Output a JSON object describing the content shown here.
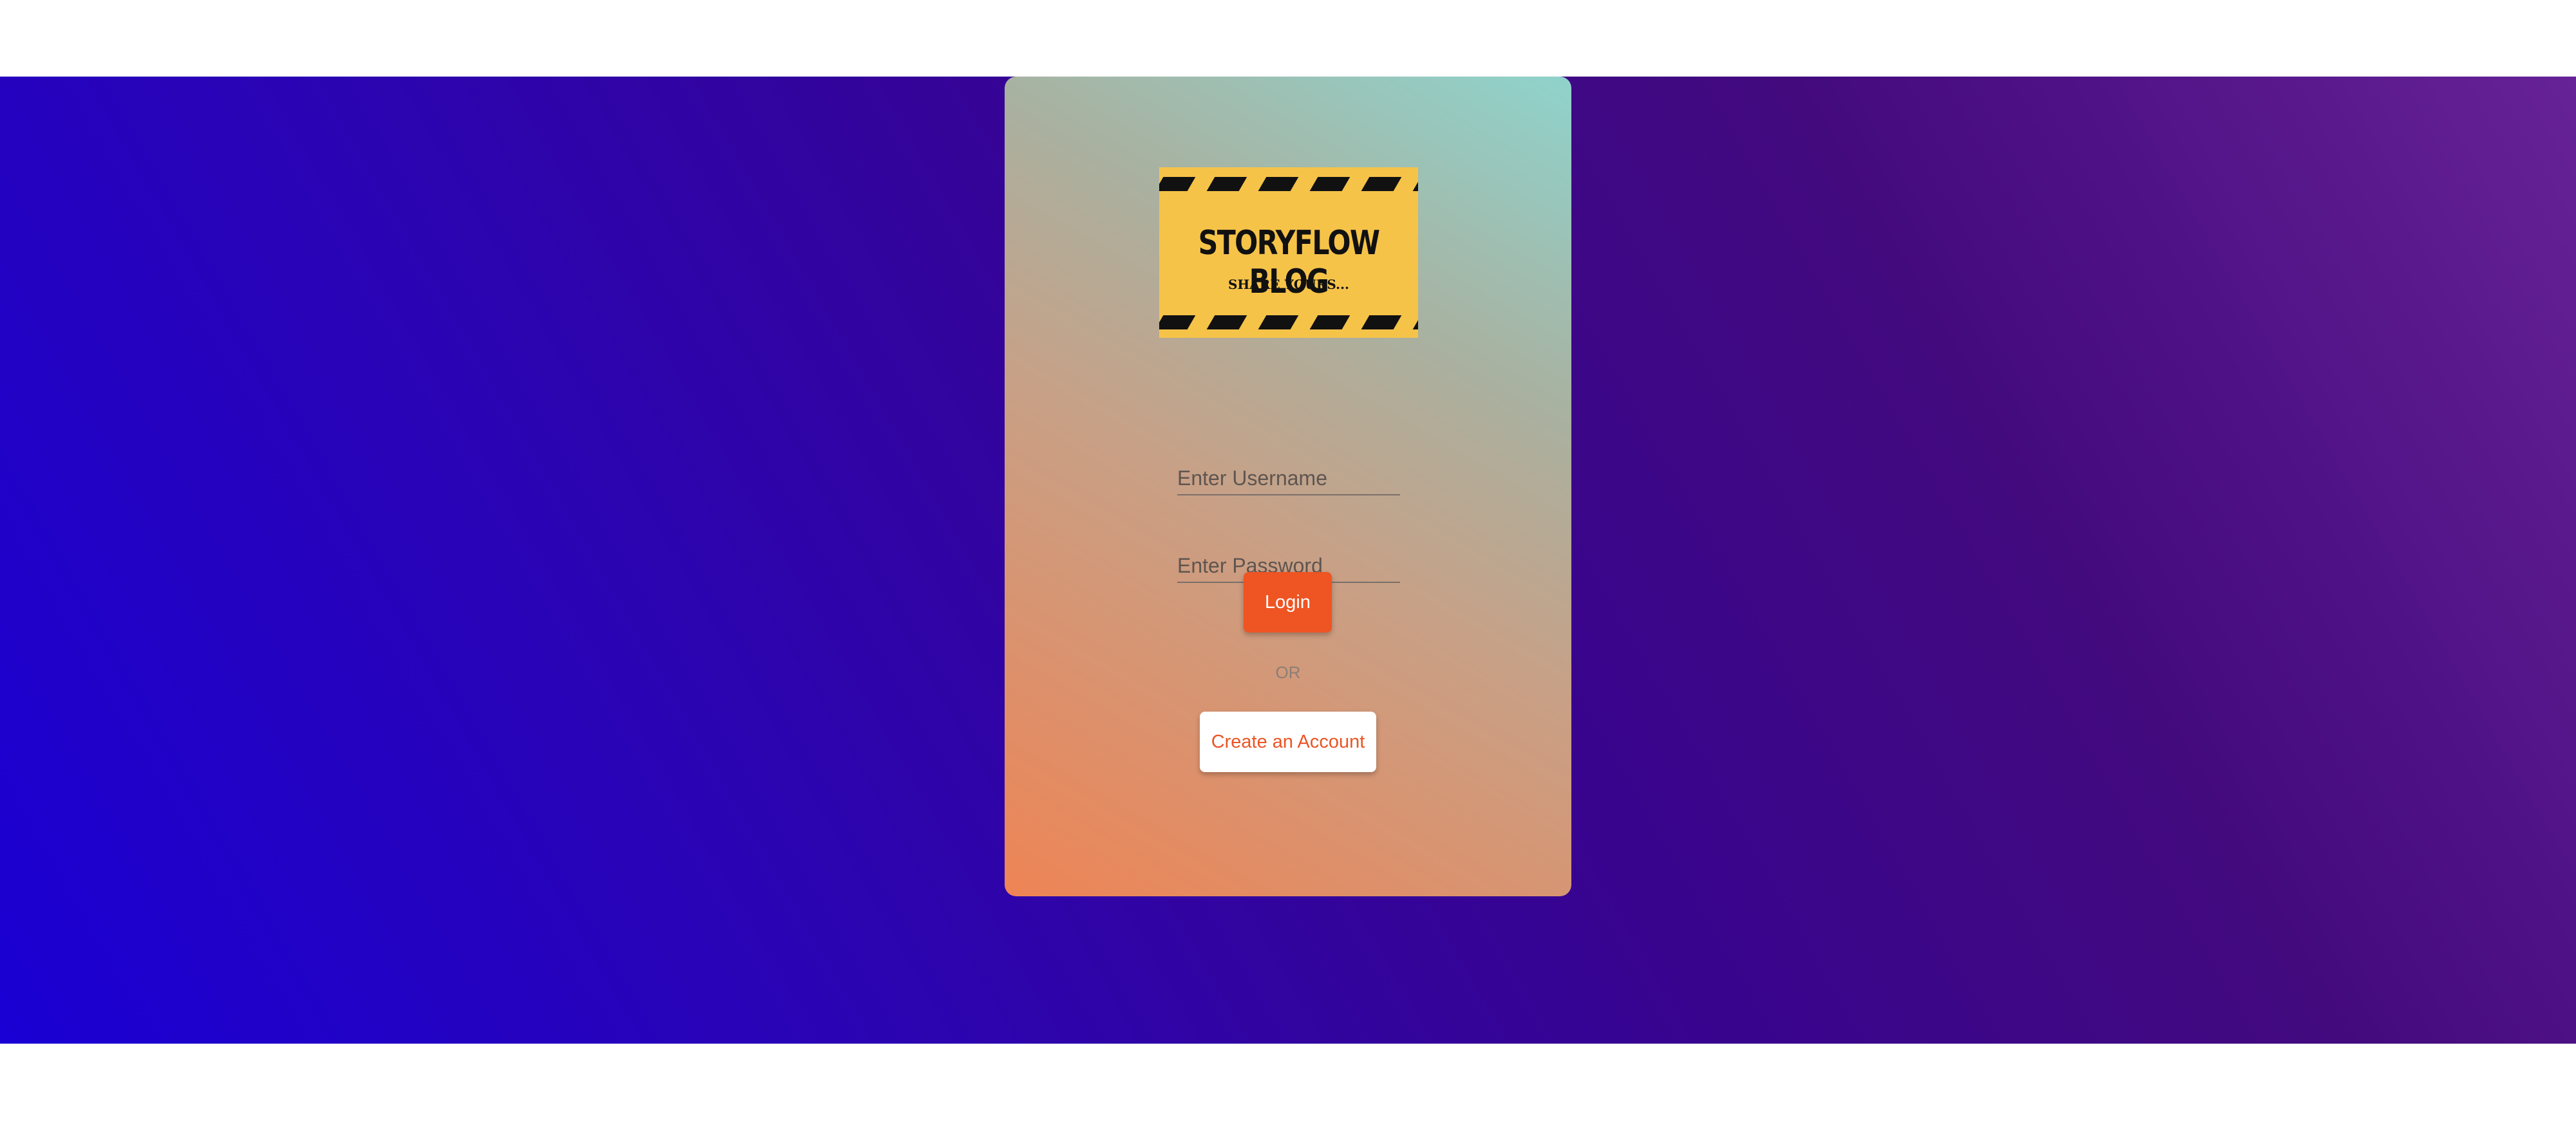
{
  "colors": {
    "background_start": "#1a00d4",
    "background_end": "#662296",
    "card_gradient_start": "#ee8455",
    "card_gradient_end": "#8fd3cc",
    "logo_yellow": "#f6c349",
    "accent_orange": "#ef5423"
  },
  "logo": {
    "title": "STORYFLOW BLOG",
    "subtitle": "SHARE YOURS..."
  },
  "form": {
    "username_placeholder": "Enter Username",
    "password_placeholder": "Enter Password",
    "login_label": "Login",
    "or_label": "OR",
    "create_account_label": "Create an Account"
  }
}
